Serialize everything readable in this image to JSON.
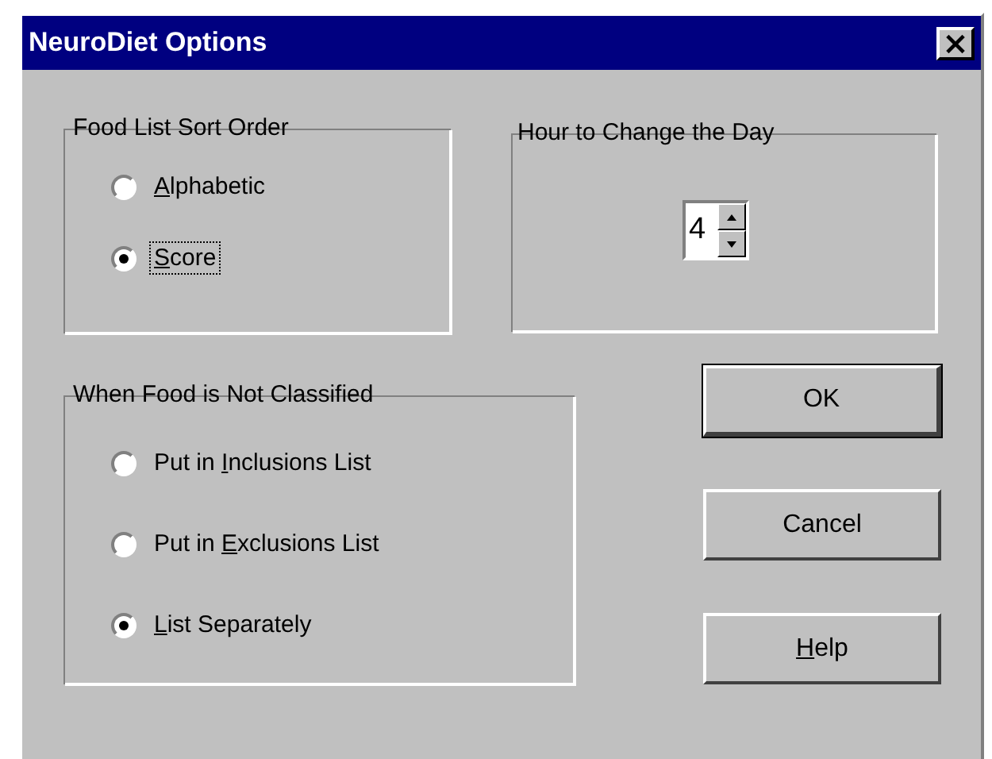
{
  "window": {
    "title": "NeuroDiet Options",
    "close_glyph": "×"
  },
  "sort_order": {
    "title": "Food List Sort Order",
    "options": [
      {
        "access_key": "A",
        "after": "lphabetic",
        "selected": false,
        "focused": false
      },
      {
        "access_key": "S",
        "after": "core",
        "selected": true,
        "focused": true
      }
    ]
  },
  "day_change": {
    "title": "Hour to Change the Day",
    "value": "4"
  },
  "unclassified": {
    "title": "When Food is Not Classified",
    "options": [
      {
        "before": "Put in ",
        "access_key": "I",
        "after": "nclusions List",
        "selected": false,
        "focused": false
      },
      {
        "before": "Put in ",
        "access_key": "E",
        "after": "xclusions List",
        "selected": false,
        "focused": false
      },
      {
        "access_key": "L",
        "after": "ist Separately",
        "selected": true,
        "focused": false
      }
    ]
  },
  "buttons": [
    {
      "label": "OK",
      "default": true
    },
    {
      "label": "Cancel",
      "default": false
    },
    {
      "access_key": "H",
      "after": "elp",
      "default": false
    }
  ]
}
